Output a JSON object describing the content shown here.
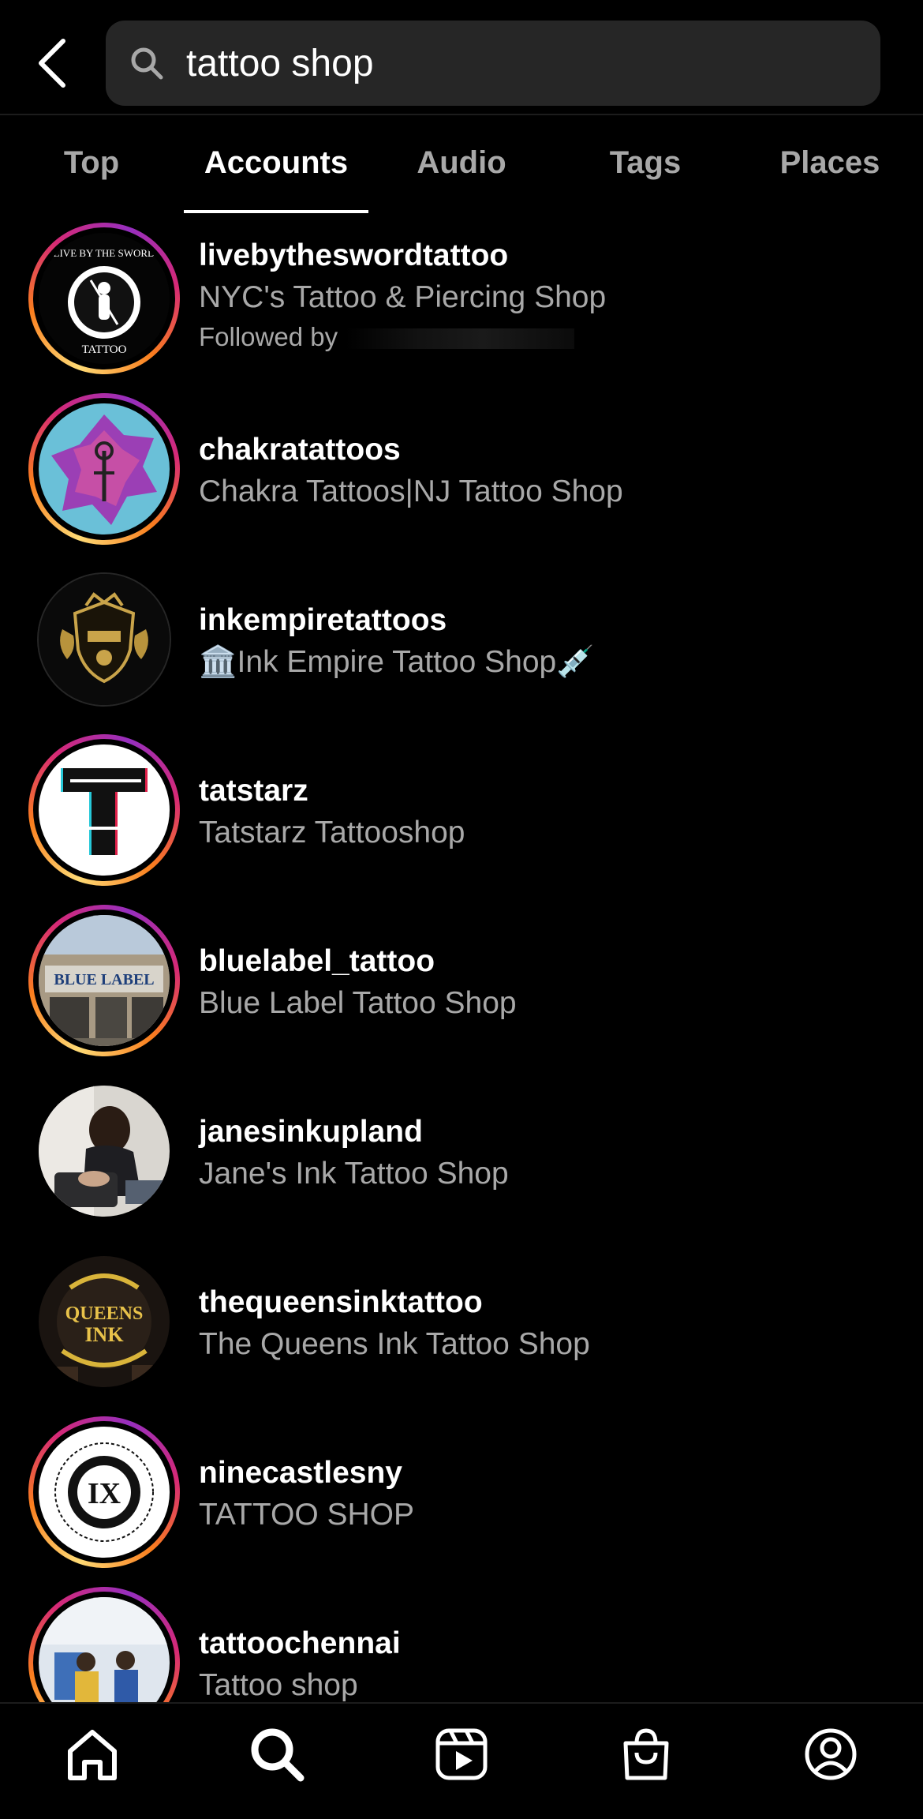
{
  "search": {
    "query": "tattoo shop"
  },
  "tabs": [
    {
      "label": "Top"
    },
    {
      "label": "Accounts"
    },
    {
      "label": "Audio"
    },
    {
      "label": "Tags"
    },
    {
      "label": "Places"
    }
  ],
  "active_tab": "Accounts",
  "results": [
    {
      "username": "livebytheswordtattoo",
      "full_name": "NYC's Tattoo & Piercing Shop",
      "followed_by": "Followed by",
      "story_ring": true
    },
    {
      "username": "chakratattoos",
      "full_name": "Chakra Tattoos|NJ Tattoo Shop",
      "story_ring": true
    },
    {
      "username": "inkempiretattoos",
      "full_name": "🏛️Ink Empire Tattoo Shop💉",
      "story_ring": false
    },
    {
      "username": "tatstarz",
      "full_name": "Tatstarz Tattooshop",
      "story_ring": true
    },
    {
      "username": "bluelabel_tattoo",
      "full_name": "Blue Label  Tattoo Shop",
      "story_ring": true
    },
    {
      "username": "janesinkupland",
      "full_name": "Jane's Ink Tattoo Shop",
      "story_ring": false
    },
    {
      "username": "thequeensinktattoo",
      "full_name": "The Queens Ink Tattoo Shop",
      "story_ring": false
    },
    {
      "username": "ninecastlesny",
      "full_name": "TATTOO SHOP",
      "story_ring": true
    },
    {
      "username": "tattoochennai",
      "full_name": "Tattoo shop",
      "story_ring": true
    }
  ],
  "avatar_art": {
    "livebytheswordtattoo": {
      "top": "LIVE BY THE SWORD",
      "bottom": "TATTOO"
    },
    "bluelabel_tattoo": {
      "sign": "BLUE LABEL"
    },
    "thequeensinktattoo": {
      "line1": "QUEENS",
      "line2": "INK"
    },
    "ninecastlesny": {
      "mark": "IX"
    }
  },
  "bottom_nav": [
    {
      "icon": "home-icon"
    },
    {
      "icon": "search-icon"
    },
    {
      "icon": "reels-icon"
    },
    {
      "icon": "shop-icon"
    },
    {
      "icon": "profile-icon"
    }
  ],
  "colors": {
    "background": "#000000",
    "search_field": "#262626",
    "secondary_text": "#a8a8a8",
    "primary_text": "#ffffff"
  }
}
